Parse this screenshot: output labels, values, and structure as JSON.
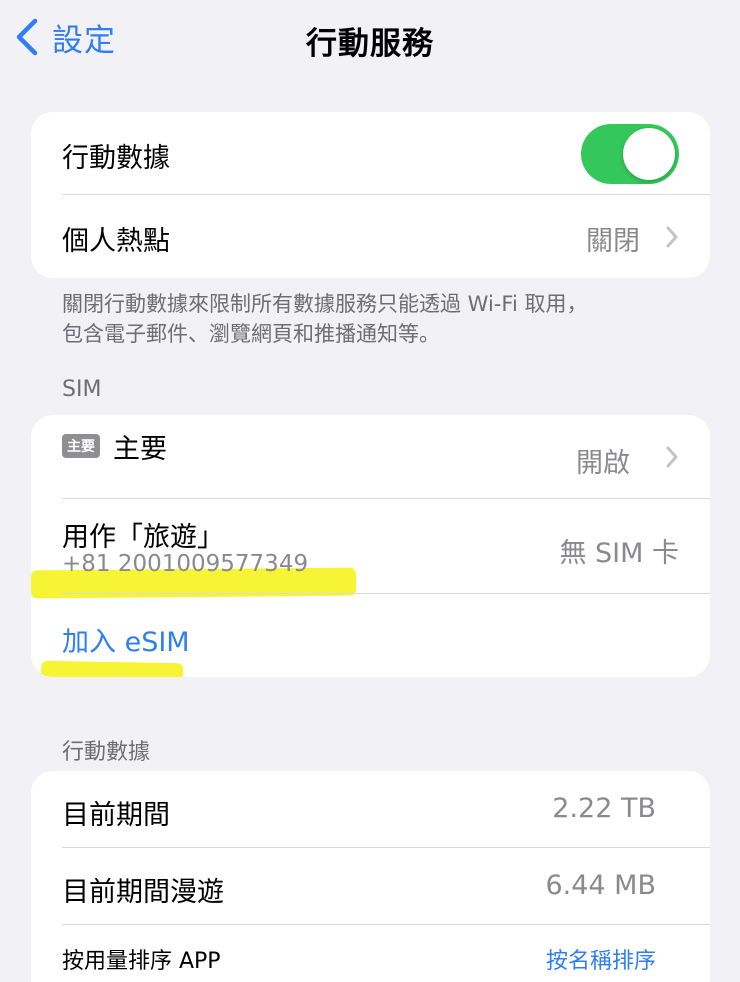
{
  "navbar": {
    "back_label": "設定",
    "title": "行動服務"
  },
  "data_card": {
    "cellular_data_label": "行動數據",
    "cellular_data_on": true,
    "hotspot_label": "個人熱點",
    "hotspot_value": "關閉"
  },
  "data_footer": {
    "line1": "關閉行動數據來限制所有數據服務只能透過 Wi-Fi 取用，",
    "line2": "包含電子郵件、瀏覽網頁和推播通知等。"
  },
  "sim_section": {
    "header": "SIM",
    "primary_badge": "主要",
    "primary_label": "主要",
    "primary_value": "開啟",
    "travel_label": "用作「旅遊」",
    "travel_number": "+81 2001009577349",
    "travel_value": "無 SIM 卡",
    "add_esim_label": "加入 eSIM"
  },
  "usage_section": {
    "header": "行動數據",
    "current_period_label": "目前期間",
    "current_period_value": "2.22 TB",
    "roaming_label": "目前期間漫遊",
    "roaming_value": "6.44 MB",
    "sort_label": "按用量排序 APP",
    "sort_value": "按名稱排序"
  },
  "colors": {
    "accent": "#2f7ef2",
    "toggle_on": "#34c759",
    "background": "#f2f2f6",
    "annotation_highlight": "#f6f32a"
  }
}
